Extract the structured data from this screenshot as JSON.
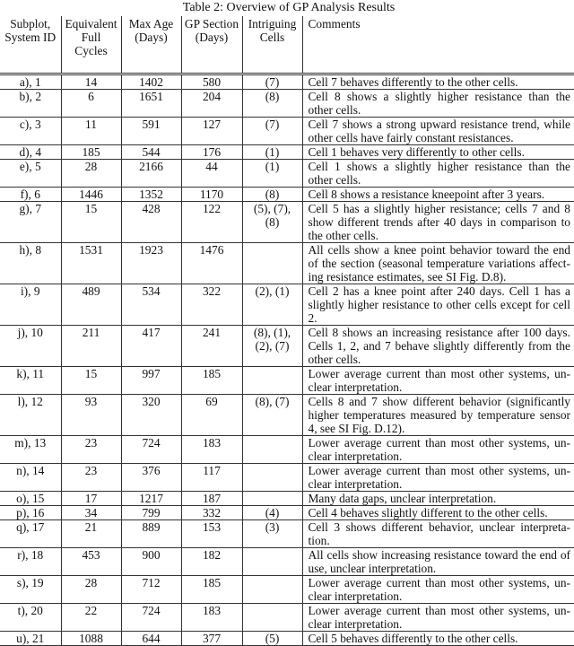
{
  "caption": "Table 2: Overview of GP Analysis Results",
  "headers": [
    "Subplot, System ID",
    "Equivalent Full Cycles",
    "Max Age (Days)",
    "GP Section (Days)",
    "Intriguing Cells",
    "Comments"
  ],
  "rows": [
    {
      "id": "a), 1",
      "efc": "14",
      "max_age": "1402",
      "gp_section": "580",
      "cells": "(7)",
      "comment": "Cell 7 behaves differently to the other cells."
    },
    {
      "id": "b), 2",
      "efc": "6",
      "max_age": "1651",
      "gp_section": "204",
      "cells": "(8)",
      "comment": "Cell 8 shows a slightly higher resistance than the other cells."
    },
    {
      "id": "c), 3",
      "efc": "11",
      "max_age": "591",
      "gp_section": "127",
      "cells": "(7)",
      "comment": "Cell 7 shows a strong upward resistance trend, while other cells have fairly constant resistances."
    },
    {
      "id": "d), 4",
      "efc": "185",
      "max_age": "544",
      "gp_section": "176",
      "cells": "(1)",
      "comment": "Cell 1 behaves very differently to other cells."
    },
    {
      "id": "e), 5",
      "efc": "28",
      "max_age": "2166",
      "gp_section": "44",
      "cells": "(1)",
      "comment": "Cell 1 shows a slightly higher resistance than the other cells."
    },
    {
      "id": "f), 6",
      "efc": "1446",
      "max_age": "1352",
      "gp_section": "1170",
      "cells": "(8)",
      "comment": "Cell 8 shows a resistance kneepoint after 3 years."
    },
    {
      "id": "g), 7",
      "efc": "15",
      "max_age": "428",
      "gp_section": "122",
      "cells": "(5), (7), (8)",
      "comment": "Cell 5 has a slightly higher resistance; cells 7 and 8 show different trends after 40 days in comparison to the other cells."
    },
    {
      "id": "h), 8",
      "efc": "1531",
      "max_age": "1923",
      "gp_section": "1476",
      "cells": "",
      "comment": "All cells show a knee point behavior toward the end of the section (seasonal temperature variations affect­ing resistance estimates, see SI Fig. D.8)."
    },
    {
      "id": "i), 9",
      "efc": "489",
      "max_age": "534",
      "gp_section": "322",
      "cells": "(2), (1)",
      "comment": "Cell 2 has a knee point after 240 days. Cell 1 has a slightly higher resistance to other cells except for cell 2."
    },
    {
      "id": "j), 10",
      "efc": "211",
      "max_age": "417",
      "gp_section": "241",
      "cells": "(8), (1), (2), (7)",
      "comment": "Cell 8 shows an increasing resistance after 100 days. Cells 1, 2, and 7 behave slightly differently from the other cells."
    },
    {
      "id": "k), 11",
      "efc": "15",
      "max_age": "997",
      "gp_section": "185",
      "cells": "",
      "comment": "Lower average current than most other systems, un­clear interpretation."
    },
    {
      "id": "l), 12",
      "efc": "93",
      "max_age": "320",
      "gp_section": "69",
      "cells": "(8), (7)",
      "comment": "Cells 8 and 7 show different behavior (significantly higher temperatures measured by temperature sensor 4, see SI Fig. D.12)."
    },
    {
      "id": "m), 13",
      "efc": "23",
      "max_age": "724",
      "gp_section": "183",
      "cells": "",
      "comment": "Lower average current than most other systems, un­clear interpretation."
    },
    {
      "id": "n), 14",
      "efc": "23",
      "max_age": "376",
      "gp_section": "117",
      "cells": "",
      "comment": "Lower average current than most other systems, un­clear interpretation."
    },
    {
      "id": "o), 15",
      "efc": "17",
      "max_age": "1217",
      "gp_section": "187",
      "cells": "",
      "comment": "Many data gaps, unclear interpretation."
    },
    {
      "id": "p), 16",
      "efc": "34",
      "max_age": "799",
      "gp_section": "332",
      "cells": "(4)",
      "comment": "Cell 4 behaves slightly different to the other cells."
    },
    {
      "id": "q), 17",
      "efc": "21",
      "max_age": "889",
      "gp_section": "153",
      "cells": "(3)",
      "comment": "Cell 3 shows different behavior, unclear interpreta­tion."
    },
    {
      "id": "r), 18",
      "efc": "453",
      "max_age": "900",
      "gp_section": "182",
      "cells": "",
      "comment": "All cells show increasing resistance toward the end of use, unclear interpretation."
    },
    {
      "id": "s), 19",
      "efc": "28",
      "max_age": "712",
      "gp_section": "185",
      "cells": "",
      "comment": "Lower average current than most other systems, un­clear interpretation."
    },
    {
      "id": "t), 20",
      "efc": "22",
      "max_age": "724",
      "gp_section": "183",
      "cells": "",
      "comment": "Lower average current than most other systems, un­clear interpretation."
    },
    {
      "id": "u), 21",
      "efc": "1088",
      "max_age": "644",
      "gp_section": "377",
      "cells": "(5)",
      "comment": "Cell 5 behaves differently to the other cells."
    }
  ]
}
